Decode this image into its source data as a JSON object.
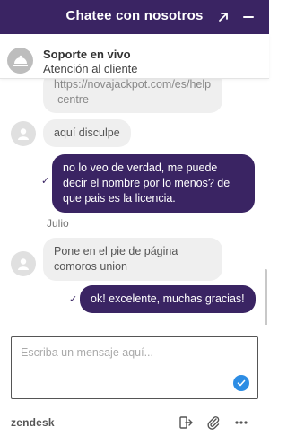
{
  "header": {
    "title": "Chatee con nosotros",
    "expand_icon": "expand-arrow-icon",
    "close_icon": "minimize-icon",
    "background": "#3a2463"
  },
  "agent": {
    "name": "Soporte en vivo",
    "subtitle": "Atención al cliente",
    "avatar_icon": "concierge-bell-icon"
  },
  "messages": [
    {
      "from": "visitor",
      "text": "https://novajackpot.com/es/help-centre"
    },
    {
      "from": "visitor",
      "text": "aquí disculpe"
    },
    {
      "from": "agent",
      "text": "no lo veo de verdad, me puede decir el nombre por lo menos? de que pais es la licencia.",
      "status": "✓"
    },
    {
      "from": "visitor",
      "sender": "Julio",
      "text": "Pone en el pie de página comoros union"
    },
    {
      "from": "agent",
      "text": "ok! excelente, muchas gracias!",
      "status": "✓"
    }
  ],
  "composer": {
    "placeholder": "Escriba un mensaje aquí...",
    "value": "",
    "send_icon": "send-check-icon",
    "send_color": "#2d8de4"
  },
  "footer": {
    "brand": "zendesk",
    "icons": [
      "end-chat-icon",
      "attachment-icon",
      "more-options-icon"
    ]
  }
}
